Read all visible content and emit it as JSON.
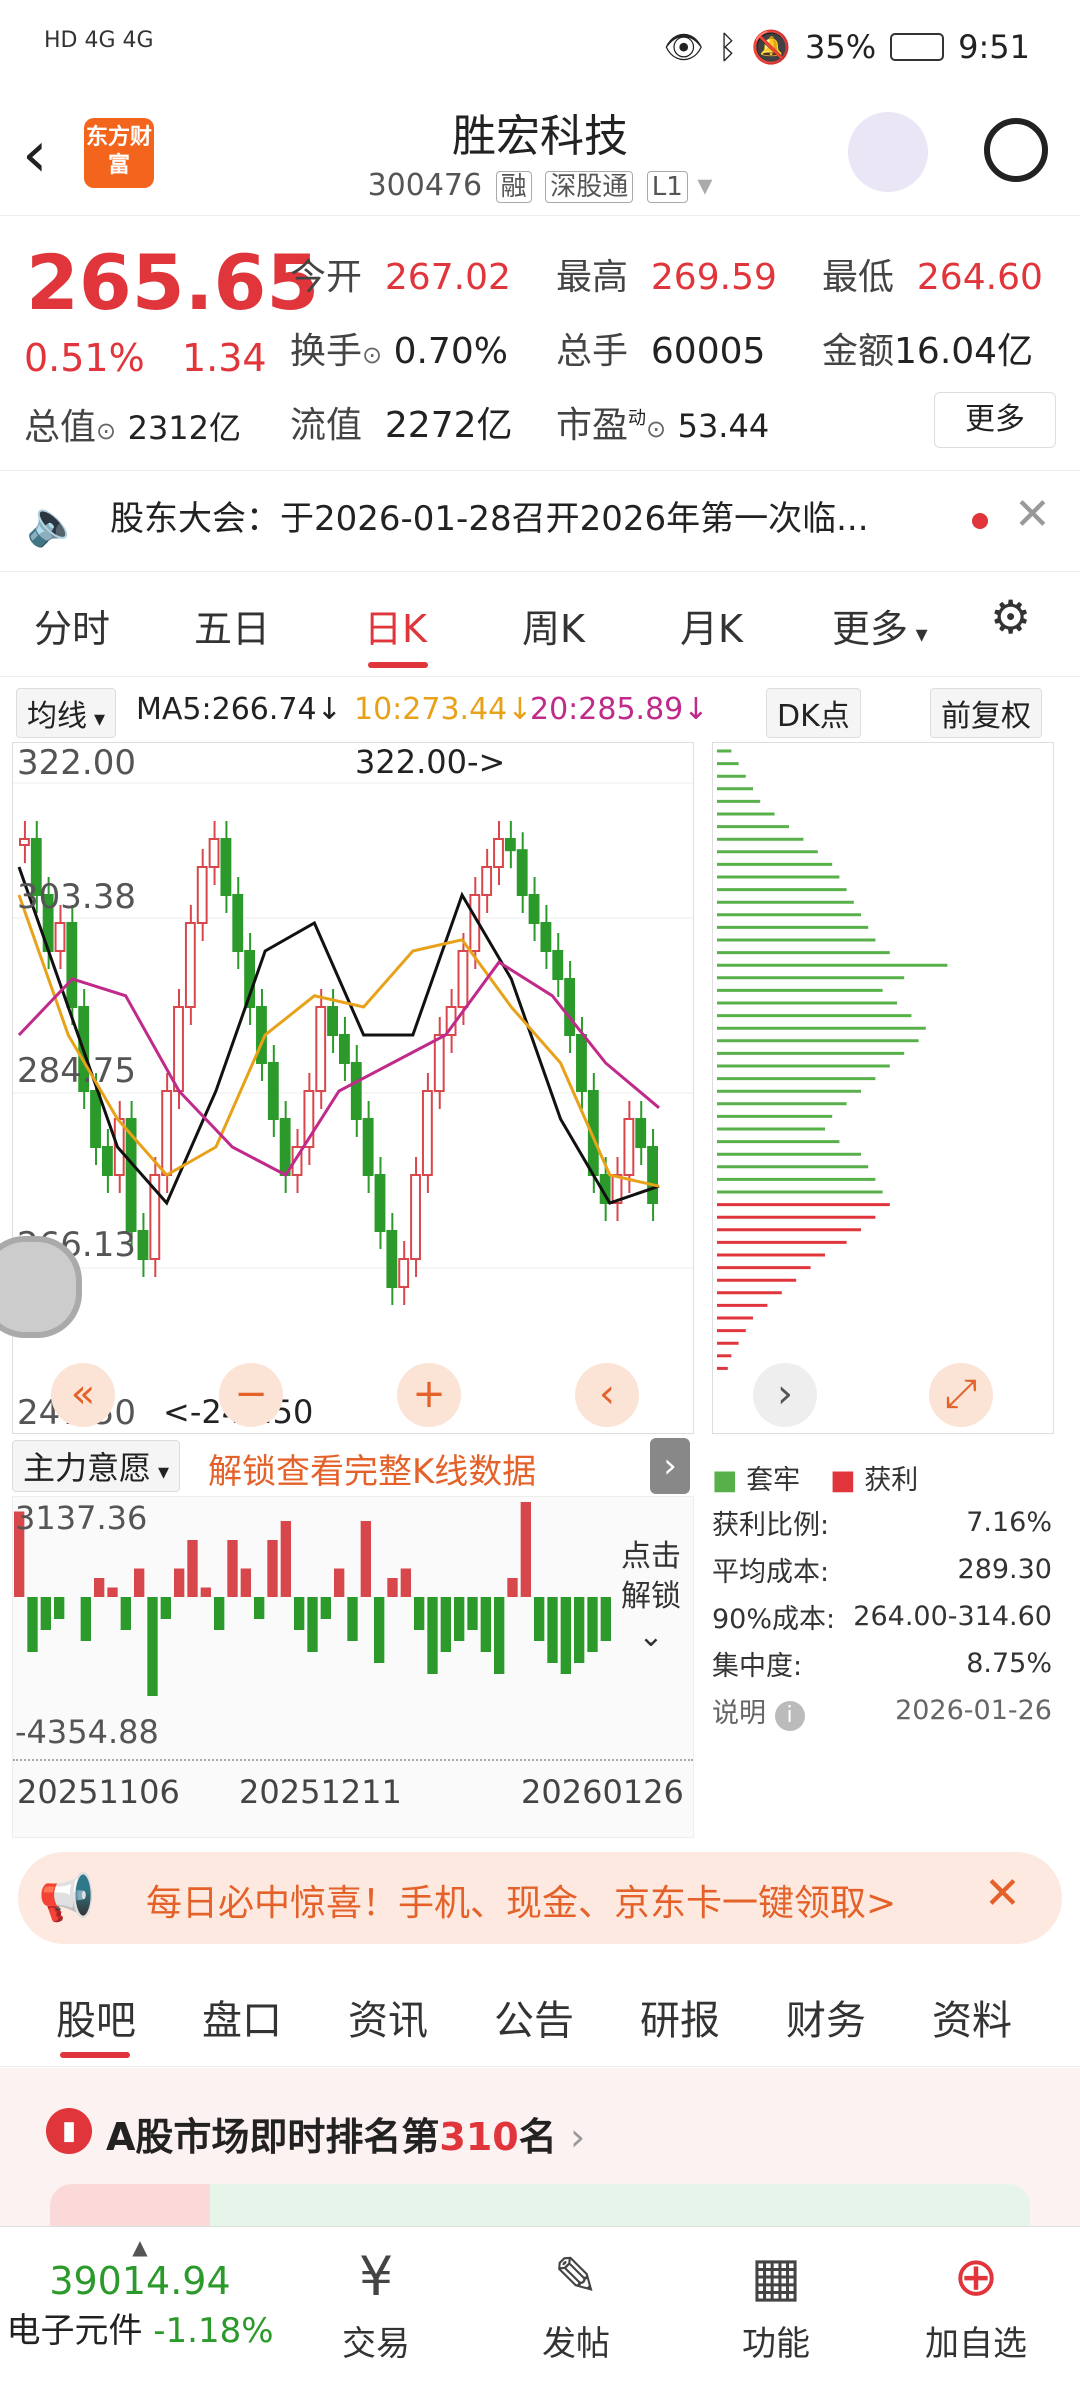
{
  "status_bar": {
    "left_icons": "HD 4G 4G",
    "battery": "35%",
    "time": "9:51"
  },
  "header": {
    "logo_text": "东方财富",
    "title": "胜宏科技",
    "code": "300476",
    "tags": [
      "融",
      "深股通",
      "L1"
    ]
  },
  "quote": {
    "price": "265.65",
    "change_pct": "0.51%",
    "change": "1.34",
    "open_label": "今开",
    "open": "267.02",
    "high_label": "最高",
    "high": "269.59",
    "low_label": "最低",
    "low": "264.60",
    "turnover_label": "换手",
    "turnover": "0.70%",
    "volume_label": "总手",
    "volume": "60005",
    "amount_label": "金额",
    "amount": "16.04亿",
    "mktcap_label": "总值",
    "mktcap": "2312亿",
    "float_label": "流值",
    "float": "2272亿",
    "pe_label": "市盈",
    "pe_sup": "动",
    "pe": "53.44",
    "more": "更多"
  },
  "notice": {
    "text": "股东大会：于2026-01-28召开2026年第一次临..."
  },
  "tabs": [
    "分时",
    "五日",
    "日K",
    "周K",
    "月K",
    "更多"
  ],
  "active_tab": "日K",
  "ma": {
    "selector": "均线",
    "ma5": "MA5:266.74",
    "ma10": "10:273.44",
    "ma20": "20:285.89",
    "dk": "DK点",
    "adjust": "前复权"
  },
  "kchart": {
    "y_labels": [
      "322.00",
      "303.38",
      "284.75",
      "266.13",
      "247.50"
    ],
    "max_note": "322.00->",
    "min_note": "<-247.50"
  },
  "sub": {
    "selector": "主力意愿",
    "unlock": "解锁查看完整K线数据",
    "top": "3137.36",
    "bottom": "-4354.88",
    "dates": [
      "20251106",
      "20251211",
      "20260126"
    ],
    "side_unlock": "点击解锁"
  },
  "chips": {
    "legend_trap": "套牢",
    "legend_profit": "获利",
    "profit_ratio_label": "获利比例:",
    "profit_ratio": "7.16%",
    "avg_cost_label": "平均成本:",
    "avg_cost": "289.30",
    "cost90_label": "90%成本:",
    "cost90": "264.00-314.60",
    "concentration_label": "集中度:",
    "concentration": "8.75%",
    "note_label": "说明",
    "date": "2026-01-26"
  },
  "banner": {
    "text": "每日必中惊喜！手机、现金、京东卡一键领取>"
  },
  "bottom_tabs": [
    "股吧",
    "盘口",
    "资讯",
    "公告",
    "研报",
    "财务",
    "资料"
  ],
  "active_bottom_tab": "股吧",
  "rank": {
    "prefix": "A股市场即时排名第",
    "num": "310",
    "suffix": "名"
  },
  "nav": {
    "index_value": "39014.94",
    "index_name": "电子元件",
    "index_change": "-1.18%",
    "items": [
      "交易",
      "发帖",
      "功能",
      "加自选"
    ]
  }
}
